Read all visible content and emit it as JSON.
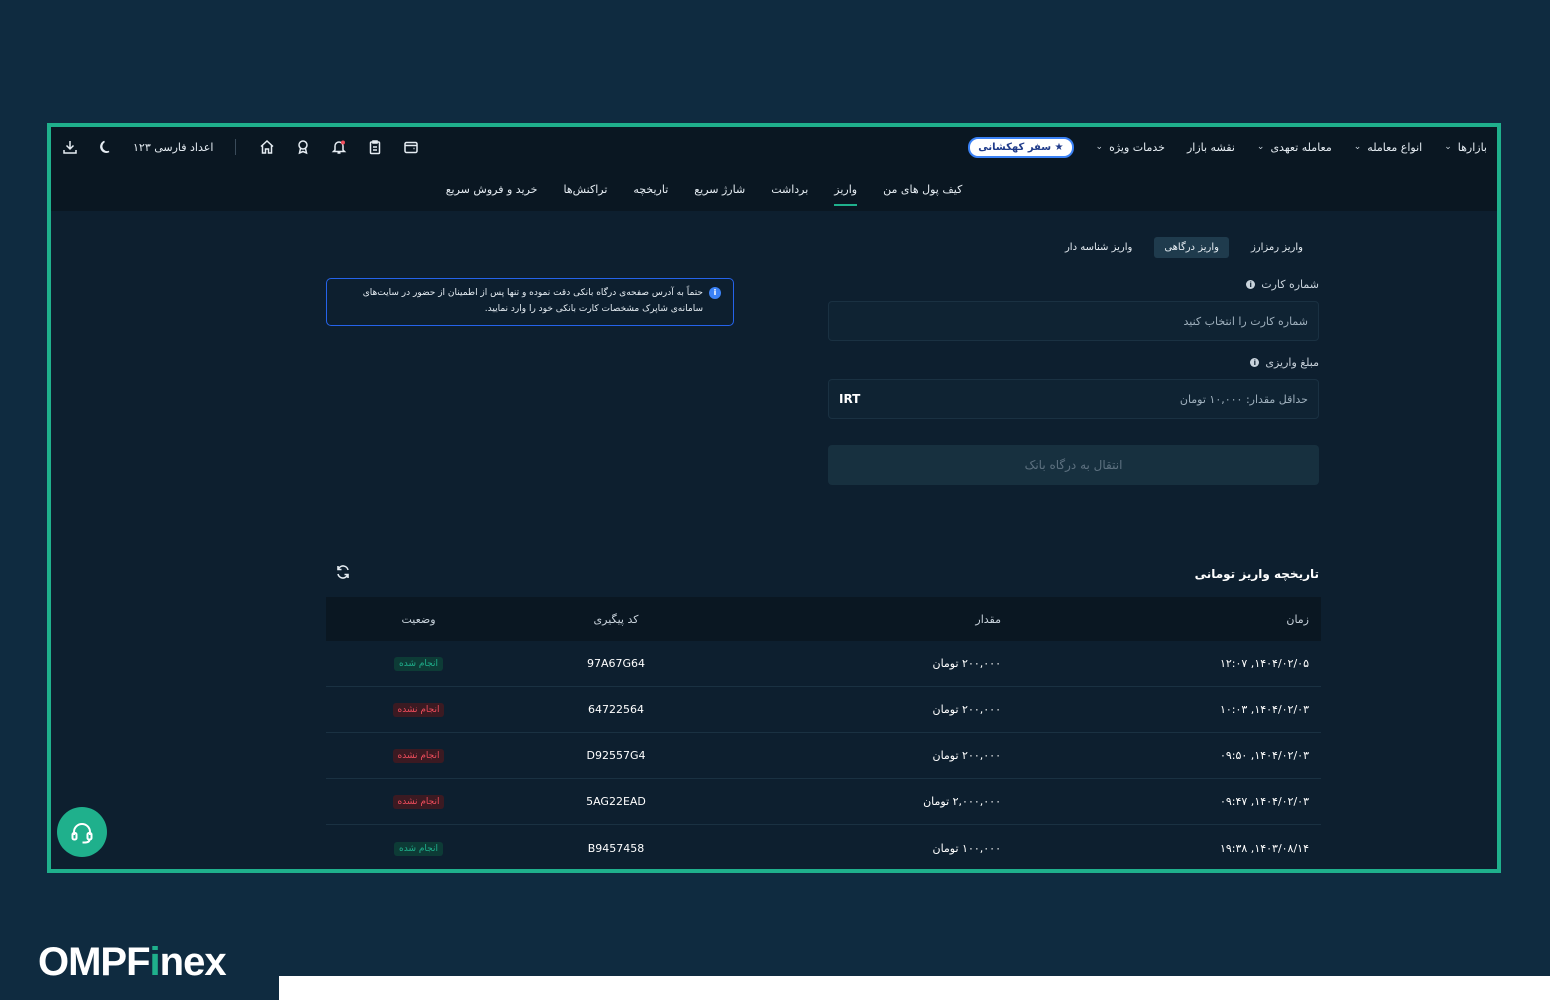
{
  "header": {
    "menu": [
      {
        "label": "بازارها",
        "chevron": true
      },
      {
        "label": "انواع معامله",
        "chevron": true
      },
      {
        "label": "معامله تعهدی",
        "chevron": true
      },
      {
        "label": "نقشه بازار",
        "chevron": false
      },
      {
        "label": "خدمات ویژه",
        "chevron": true
      }
    ],
    "galaxy_badge": "★ سفر کهکشانی",
    "persian_digits_label": "اعداد فارسی ۱۲۳"
  },
  "nav_tabs": [
    {
      "label": "کیف پول های من",
      "active": false
    },
    {
      "label": "واریز",
      "active": true
    },
    {
      "label": "برداشت",
      "active": false
    },
    {
      "label": "شارژ سریع",
      "active": false
    },
    {
      "label": "تاریخچه",
      "active": false
    },
    {
      "label": "تراکنش‌ها",
      "active": false
    },
    {
      "label": "خرید و فروش سریع",
      "active": false
    }
  ],
  "deposit_tabs": [
    {
      "label": "واریز رمزارز",
      "active": false
    },
    {
      "label": "واریز درگاهی",
      "active": true
    },
    {
      "label": "واریز شناسه دار",
      "active": false
    }
  ],
  "form": {
    "card_label": "شماره کارت",
    "card_placeholder": "شماره کارت را انتخاب کنید",
    "amount_label": "مبلغ واریزی",
    "amount_placeholder": "حداقل مقدار: ۱۰,۰۰۰ تومان",
    "amount_unit": "IRT",
    "submit_label": "انتقال به درگاه بانک"
  },
  "notice": {
    "line1": "حتماً به آدرس صفحه‌ی درگاه بانکی دقت نموده و تنها پس از اطمینان از حضور در سایت‌های",
    "line2": "سامانه‌ی شاپرک مشخصات کارت بانکی خود را وارد نمایید."
  },
  "history": {
    "title": "تاریخچه واریز تومانی",
    "columns": {
      "time": "زمان",
      "amount": "مقدار",
      "code": "کد پیگیری",
      "status": "وضعیت"
    },
    "rows": [
      {
        "time": "۱۴۰۴/۰۲/۰۵, ۱۲:۰۷",
        "amount": "۲۰۰,۰۰۰ تومان",
        "code": "97A67G64",
        "status": "انجام شده",
        "ok": true
      },
      {
        "time": "۱۴۰۴/۰۲/۰۳, ۱۰:۰۳",
        "amount": "۲۰۰,۰۰۰ تومان",
        "code": "64722564",
        "status": "انجام نشده",
        "ok": false
      },
      {
        "time": "۱۴۰۴/۰۲/۰۳, ۰۹:۵۰",
        "amount": "۲۰۰,۰۰۰ تومان",
        "code": "D92557G4",
        "status": "انجام نشده",
        "ok": false
      },
      {
        "time": "۱۴۰۴/۰۲/۰۳, ۰۹:۴۷",
        "amount": "۲,۰۰۰,۰۰۰ تومان",
        "code": "5AG22EAD",
        "status": "انجام نشده",
        "ok": false
      },
      {
        "time": "۱۴۰۳/۰۸/۱۴, ۱۹:۳۸",
        "amount": "۱۰۰,۰۰۰ تومان",
        "code": "B9457458",
        "status": "انجام شده",
        "ok": true
      }
    ]
  },
  "brand": {
    "prefix": "OMPF",
    "i": "i",
    "suffix": "nex"
  },
  "colors": {
    "accent": "#1fb08c",
    "background": "#0f2b40",
    "panel": "#0d1f2f",
    "danger": "#f04d5c",
    "info": "#3b82f6"
  }
}
